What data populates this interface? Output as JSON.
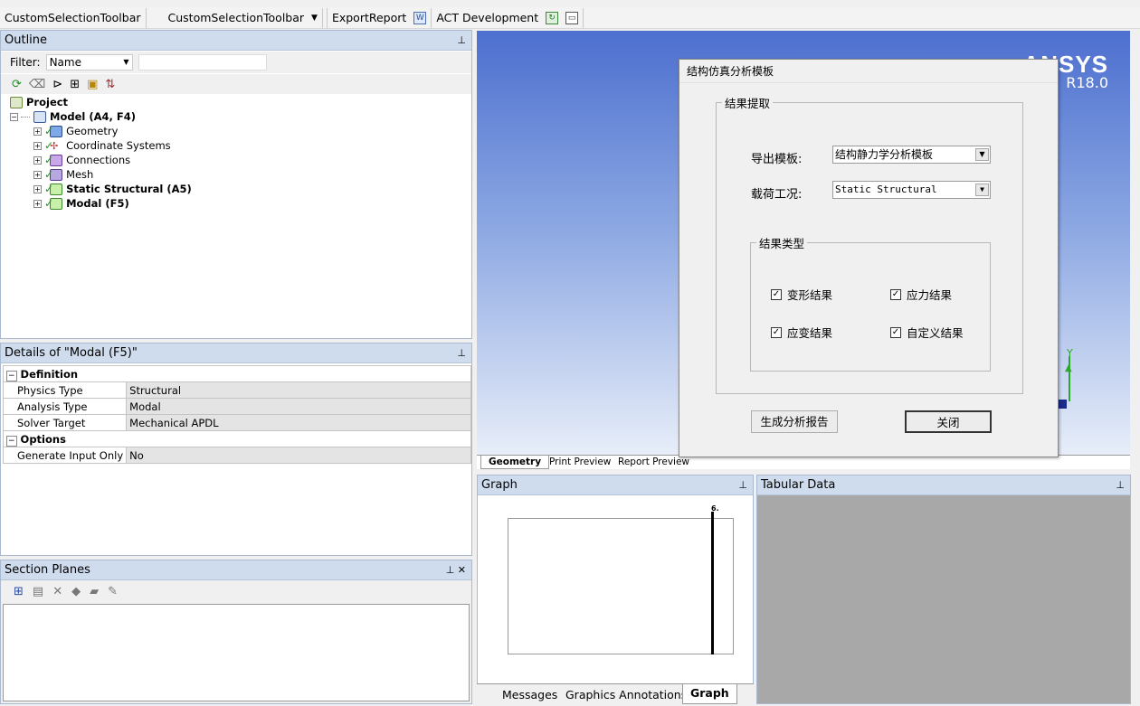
{
  "toolbar": {
    "item1": "CustomSelectionToolbar",
    "item2": "CustomSelectionToolbar",
    "item3": "ExportReport",
    "item4": "ACT Development"
  },
  "outline": {
    "title": "Outline",
    "filter_label": "Filter:",
    "filter_value": "Name",
    "tree": {
      "project": "Project",
      "model": "Model (A4, F4)",
      "geometry": "Geometry",
      "coord": "Coordinate Systems",
      "connections": "Connections",
      "mesh": "Mesh",
      "static": "Static Structural (A5)",
      "modal": "Modal (F5)"
    }
  },
  "details": {
    "title": "Details of \"Modal (F5)\"",
    "group1": "Definition",
    "rows": [
      {
        "k": "Physics Type",
        "v": "Structural"
      },
      {
        "k": "Analysis Type",
        "v": "Modal"
      },
      {
        "k": "Solver Target",
        "v": "Mechanical APDL"
      }
    ],
    "group2": "Options",
    "opt_rows": [
      {
        "k": "Generate Input Only",
        "v": "No"
      }
    ]
  },
  "section_planes": {
    "title": "Section Planes"
  },
  "viewport": {
    "logo": "ANSYS",
    "version": "R18.0",
    "axis_label": "Y",
    "tabs": [
      "Geometry",
      "Print Preview",
      "Report Preview"
    ]
  },
  "graph": {
    "title": "Graph",
    "marker_label": "6."
  },
  "tabular": {
    "title": "Tabular Data"
  },
  "bottom_tabs": [
    "Messages",
    "Graphics Annotations",
    "Graph"
  ],
  "dialog": {
    "title": "结构仿真分析模板",
    "group_result": "结果提取",
    "export_template_label": "导出模板:",
    "export_template_value": "结构静力学分析模板",
    "load_case_label": "载荷工况:",
    "load_case_value": "Static Structural",
    "group_type": "结果类型",
    "checkboxes": [
      {
        "label": "变形结果",
        "checked": true
      },
      {
        "label": "应力结果",
        "checked": true
      },
      {
        "label": "应变结果",
        "checked": true
      },
      {
        "label": "自定义结果",
        "checked": true
      }
    ],
    "generate_button": "生成分析报告",
    "close_button": "关闭"
  }
}
